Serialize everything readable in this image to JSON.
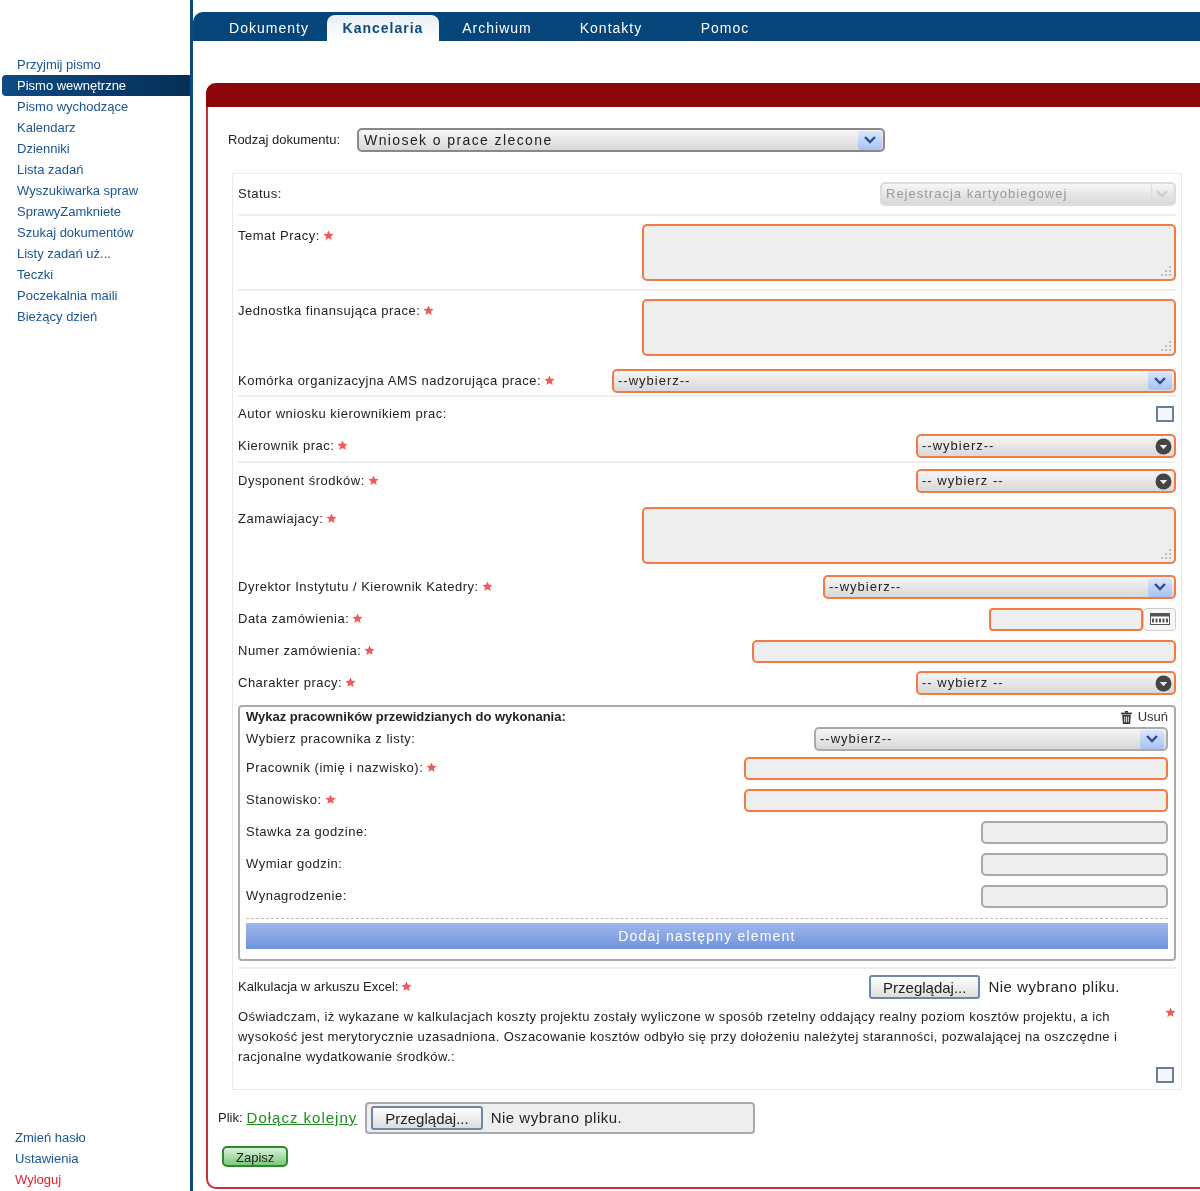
{
  "nav": {
    "tabs": [
      {
        "label": "Dokumenty",
        "selected": false
      },
      {
        "label": "Kancelaria",
        "selected": true
      },
      {
        "label": "Archiwum",
        "selected": false
      },
      {
        "label": "Kontakty",
        "selected": false
      },
      {
        "label": "Pomoc",
        "selected": false
      }
    ]
  },
  "sidebar": {
    "items": [
      {
        "label": "Przyjmij pismo",
        "selected": false
      },
      {
        "label": "Pismo wewnętrzne",
        "selected": true
      },
      {
        "label": "Pismo wychodzące",
        "selected": false
      },
      {
        "label": "Kalendarz",
        "selected": false
      },
      {
        "label": "Dzienniki",
        "selected": false
      },
      {
        "label": "Lista zadań",
        "selected": false
      },
      {
        "label": "Wyszukiwarka spraw",
        "selected": false
      },
      {
        "label": "SprawyZamkniete",
        "selected": false
      },
      {
        "label": "Szukaj dokumentów",
        "selected": false
      },
      {
        "label": "Listy zadań uż...",
        "selected": false
      },
      {
        "label": "Teczki",
        "selected": false
      },
      {
        "label": "Poczekalnia maili",
        "selected": false
      },
      {
        "label": "Bieżący dzień",
        "selected": false
      }
    ],
    "footer": [
      {
        "label": "Zmień hasło",
        "kind": "link"
      },
      {
        "label": "Ustawienia",
        "kind": "link"
      },
      {
        "label": "Wyloguj",
        "kind": "logout"
      }
    ]
  },
  "form": {
    "document_type": {
      "label": "Rodzaj dokumentu:",
      "value": "Wniosek o prace zlecone"
    },
    "groups": [
      [
        {
          "label": "Status:",
          "kind": "select",
          "required": false,
          "disabled": true,
          "value": "Rejestracja kartyobiegowej"
        }
      ],
      [
        {
          "label": "Temat Pracy:",
          "kind": "textarea",
          "required": true
        }
      ],
      [
        {
          "label": "Jednostka finansująca prace:",
          "kind": "textarea",
          "required": true
        },
        {
          "label": "Komórka organizacyjna AMS nadzorująca prace:",
          "kind": "select",
          "required": true,
          "value": "--wybierz--"
        }
      ],
      [
        {
          "label": "Autor wniosku kierownikiem prac:",
          "kind": "checkbox",
          "required": false,
          "checked": false
        },
        {
          "label": "Kierownik prac:",
          "kind": "menu",
          "required": true,
          "value": "--wybierz--"
        }
      ],
      [
        {
          "label": "Dysponent środków:",
          "kind": "menu",
          "required": true,
          "value": "-- wybierz --"
        },
        {
          "label": "Zamawiajacy:",
          "kind": "textarea",
          "required": true
        },
        {
          "label": "Dyrektor Instytutu / Kierownik Katedry:",
          "kind": "select",
          "required": true,
          "value": "--wybierz--"
        },
        {
          "label": "Data zamówienia:",
          "kind": "date",
          "required": true
        },
        {
          "label": "Numer zamówienia:",
          "kind": "text",
          "required": true
        },
        {
          "label": "Charakter pracy:",
          "kind": "menu",
          "required": true,
          "value": "-- wybierz --"
        }
      ]
    ],
    "workers": {
      "title": "Wykaz pracowników przewidzianych do wykonania:",
      "remove": "Usuń",
      "fields": [
        {
          "label": "Wybierz pracownika z listy:",
          "kind": "select",
          "required": false,
          "value": "--wybierz--"
        },
        {
          "label": "Pracownik (imię i nazwisko):",
          "kind": "text",
          "required": true
        },
        {
          "label": "Stanowisko:",
          "kind": "text",
          "required": true
        },
        {
          "label": "Stawka za godzine:",
          "kind": "short",
          "required": false
        },
        {
          "label": "Wymiar godzin:",
          "kind": "short",
          "required": false
        },
        {
          "label": "Wynagrodzenie:",
          "kind": "short",
          "required": false
        }
      ],
      "add_button": "Dodaj następny element"
    },
    "excel": {
      "label": "Kalkulacja w arkuszu Excel:",
      "required": true,
      "button": "Przeglądaj...",
      "status": "Nie wybrano pliku."
    },
    "declaration": {
      "text": "Oświadczam, iż wykazane w kalkulacjach koszty projektu zostały wyliczone w sposób rzetelny oddający realny poziom kosztów projektu, a ich wysokość jest merytorycznie uzasadniona. Oszacowanie kosztów odbyło się przy dołożeniu należytej staranności, pozwalającej na oszczędne i racjonalne wydatkowanie środków.:",
      "required": true,
      "checked": false
    },
    "attachment": {
      "label": "Plik:",
      "link": "Dołącz kolejny",
      "button": "Przeglądaj...",
      "status": "Nie wybrano pliku."
    },
    "save_button": "Zapisz"
  }
}
